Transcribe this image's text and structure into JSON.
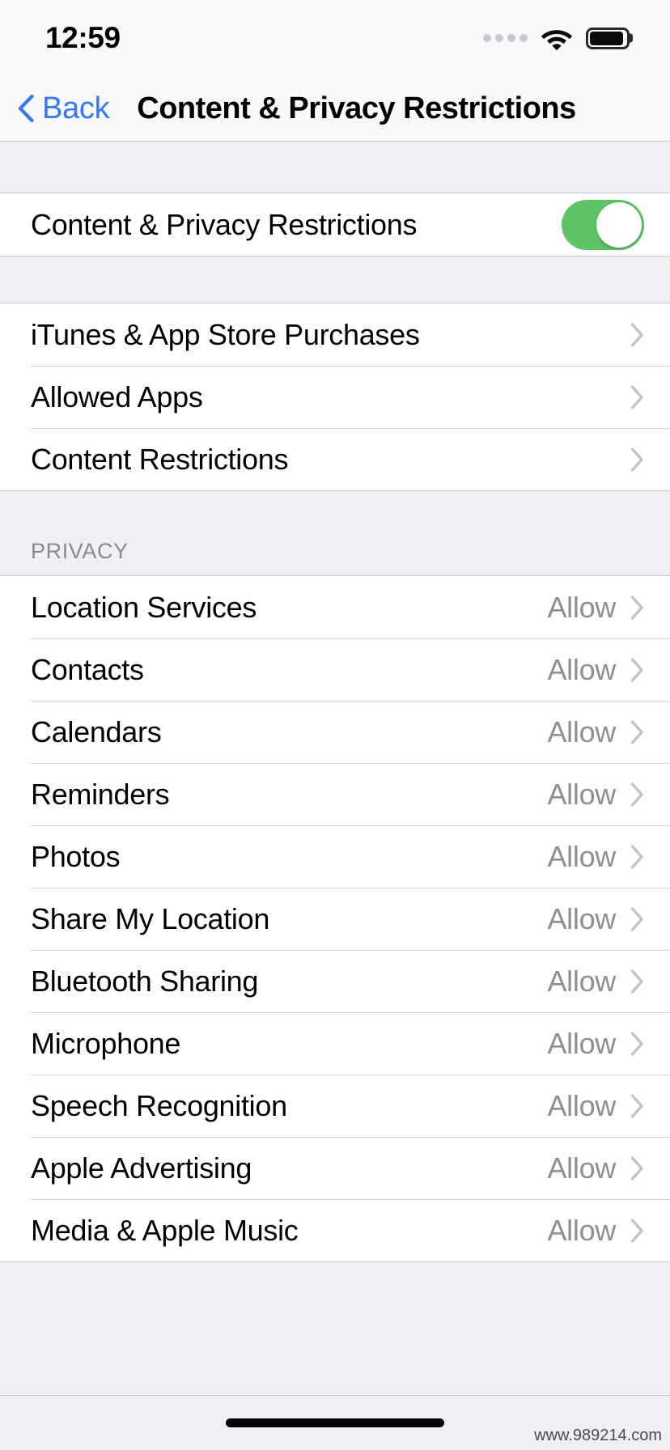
{
  "status_bar": {
    "time": "12:59",
    "signal_icon": "signal-dots-icon",
    "wifi_icon": "wifi-icon",
    "battery_icon": "battery-icon"
  },
  "nav": {
    "back_label": "Back",
    "title": "Content & Privacy Restrictions"
  },
  "master_toggle": {
    "label": "Content & Privacy Restrictions",
    "state": "on",
    "on_color": "#5EC466"
  },
  "restriction_rows": [
    {
      "label": "iTunes & App Store Purchases"
    },
    {
      "label": "Allowed Apps"
    },
    {
      "label": "Content Restrictions"
    }
  ],
  "privacy_section": {
    "header": "PRIVACY",
    "rows": [
      {
        "label": "Location Services",
        "value": "Allow"
      },
      {
        "label": "Contacts",
        "value": "Allow"
      },
      {
        "label": "Calendars",
        "value": "Allow"
      },
      {
        "label": "Reminders",
        "value": "Allow"
      },
      {
        "label": "Photos",
        "value": "Allow"
      },
      {
        "label": "Share My Location",
        "value": "Allow"
      },
      {
        "label": "Bluetooth Sharing",
        "value": "Allow"
      },
      {
        "label": "Microphone",
        "value": "Allow"
      },
      {
        "label": "Speech Recognition",
        "value": "Allow"
      },
      {
        "label": "Apple Advertising",
        "value": "Allow"
      },
      {
        "label": "Media & Apple Music",
        "value": "Allow"
      }
    ]
  },
  "footer": {
    "home_indicator": "home-indicator",
    "watermark": "www.989214.com"
  },
  "colors": {
    "accent_blue": "#3478F6",
    "toggle_green": "#5EC466",
    "value_gray": "#8E8E93",
    "group_bg": "#EFEFF4"
  }
}
